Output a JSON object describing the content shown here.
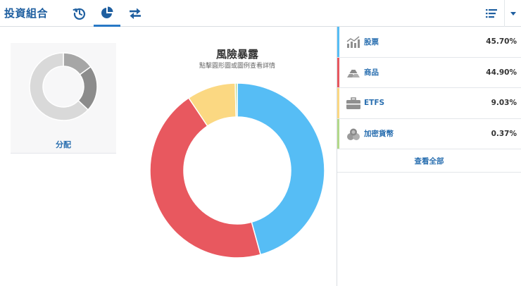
{
  "header": {
    "title": "投資組合",
    "tabs": [
      {
        "icon": "history-icon",
        "active": false
      },
      {
        "icon": "pie-chart-icon",
        "active": true
      },
      {
        "icon": "transfer-arrows-icon",
        "active": false
      }
    ],
    "list_icon": "list-icon",
    "menu_icon": "caret-down-icon"
  },
  "allocation_card": {
    "label": "分配",
    "segments": [
      {
        "value": 15,
        "color": "#a6a6a6"
      },
      {
        "value": 22,
        "color": "#8c8c8c"
      },
      {
        "value": 63,
        "color": "#d9d9d9"
      }
    ]
  },
  "chart_data": {
    "type": "pie",
    "title": "風險暴露",
    "subtitle": "點擊圓形圖或圖例查看詳情",
    "categories": [
      "股票",
      "商品",
      "ETFS",
      "加密貨幣"
    ],
    "values": [
      45.7,
      44.9,
      9.03,
      0.37
    ],
    "colors": [
      "#56bdf5",
      "#e8585f",
      "#fbd882",
      "#b3d98a"
    ]
  },
  "breakdown": {
    "rows": [
      {
        "label": "股票",
        "value": "45.70%",
        "color": "#56bdf5",
        "icon": "stocks-chart-icon"
      },
      {
        "label": "商品",
        "value": "44.90%",
        "color": "#e8585f",
        "icon": "commodities-icon"
      },
      {
        "label": "ETFS",
        "value": "9.03%",
        "color": "#fbd882",
        "icon": "briefcase-icon"
      },
      {
        "label": "加密貨幣",
        "value": "0.37%",
        "color": "#b3d98a",
        "icon": "crypto-coins-icon"
      }
    ],
    "view_all": "查看全部"
  }
}
